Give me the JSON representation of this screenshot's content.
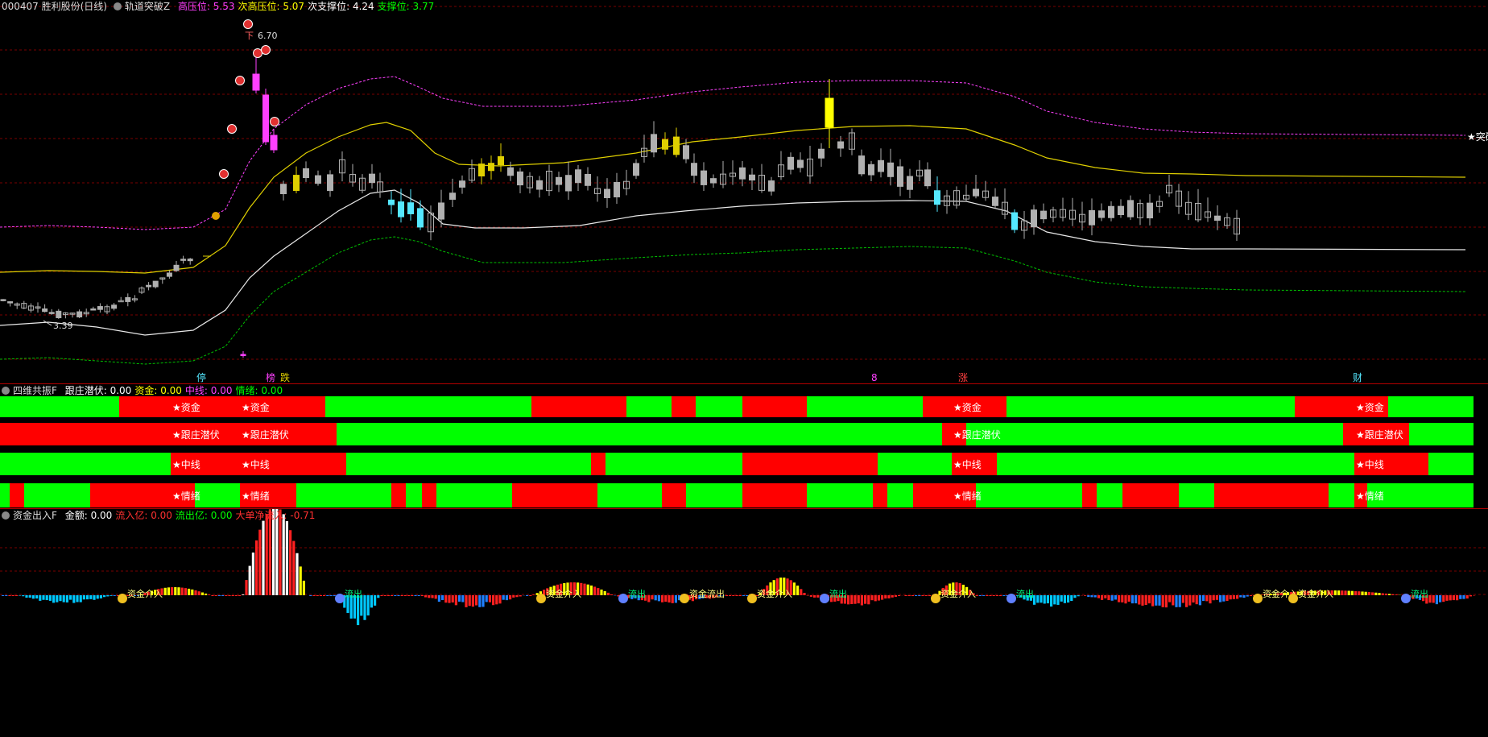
{
  "main_header": {
    "stock": "000407 胜利股份(日线)",
    "indicator": "轨道突破Z",
    "items": [
      {
        "label": "高压位:",
        "value": "5.53",
        "color": "#ff40ff"
      },
      {
        "label": "次高压位:",
        "value": "5.07",
        "color": "#ffff00"
      },
      {
        "label": "次支撑位:",
        "value": "4.24",
        "color": "#ffffff"
      },
      {
        "label": "支撑位:",
        "value": "3.77",
        "color": "#00ff00"
      }
    ]
  },
  "main_labels": {
    "high": "6.70",
    "high_arrow": "下",
    "low": "3.39",
    "breakout": "★突破"
  },
  "bottom_tags": [
    "停",
    "榜",
    "跌",
    "8",
    "涨",
    "财"
  ],
  "mid_header": {
    "indicator": "四维共振F",
    "items": [
      {
        "label": "跟庄潜伏:",
        "value": "0.00",
        "color": "#ffffff"
      },
      {
        "label": "资金:",
        "value": "0.00",
        "color": "#ffff00"
      },
      {
        "label": "中线:",
        "value": "0.00",
        "color": "#ff40ff"
      },
      {
        "label": "情绪:",
        "value": "0.00",
        "color": "#00ff00"
      }
    ]
  },
  "resonance_rows": [
    {
      "name": "资金",
      "labels": [
        "★资金",
        "★资金",
        "★资金",
        "★资金"
      ]
    },
    {
      "name": "跟庄潜伏",
      "labels": [
        "★跟庄潜伏",
        "★跟庄潜伏",
        "★跟庄潜伏",
        "★跟庄潜伏"
      ]
    },
    {
      "name": "中线",
      "labels": [
        "★中线",
        "★中线",
        "★中线",
        "★中线"
      ]
    },
    {
      "name": "情绪",
      "labels": [
        "★情绪",
        "★情绪",
        "★情绪",
        "★情绪"
      ]
    }
  ],
  "flow_header": {
    "indicator": "资金出入F",
    "items": [
      {
        "label": "金额:",
        "value": "0.00",
        "color": "#ffffff"
      },
      {
        "label": "流入亿:",
        "value": "0.00",
        "color": "#ff3030"
      },
      {
        "label": "流出亿:",
        "value": "0.00",
        "color": "#00ff00"
      },
      {
        "label": "大单净流入:",
        "value": "-0.71",
        "color": "#ff3030"
      }
    ]
  },
  "flow_labels": [
    "资金介入",
    "流出",
    "资金介入",
    "流出",
    "资金流出",
    "资金介入",
    "流出",
    "资金介入",
    "流出",
    "资金介入",
    "资金介入",
    "流出"
  ],
  "chart_data": {
    "type": "candlestick",
    "title": "000407 胜利股份(日线)",
    "levels": {
      "高压位": 5.53,
      "次高压位": 5.07,
      "次支撑位": 4.24,
      "支撑位": 3.77
    },
    "price_high": 6.7,
    "price_low": 3.39,
    "series": [
      {
        "name": "高压位",
        "color": "#ff40ff"
      },
      {
        "name": "次高压位",
        "color": "#ffff00"
      },
      {
        "name": "次支撑位",
        "color": "#ffffff"
      },
      {
        "name": "支撑位",
        "color": "#00ff00"
      }
    ]
  }
}
